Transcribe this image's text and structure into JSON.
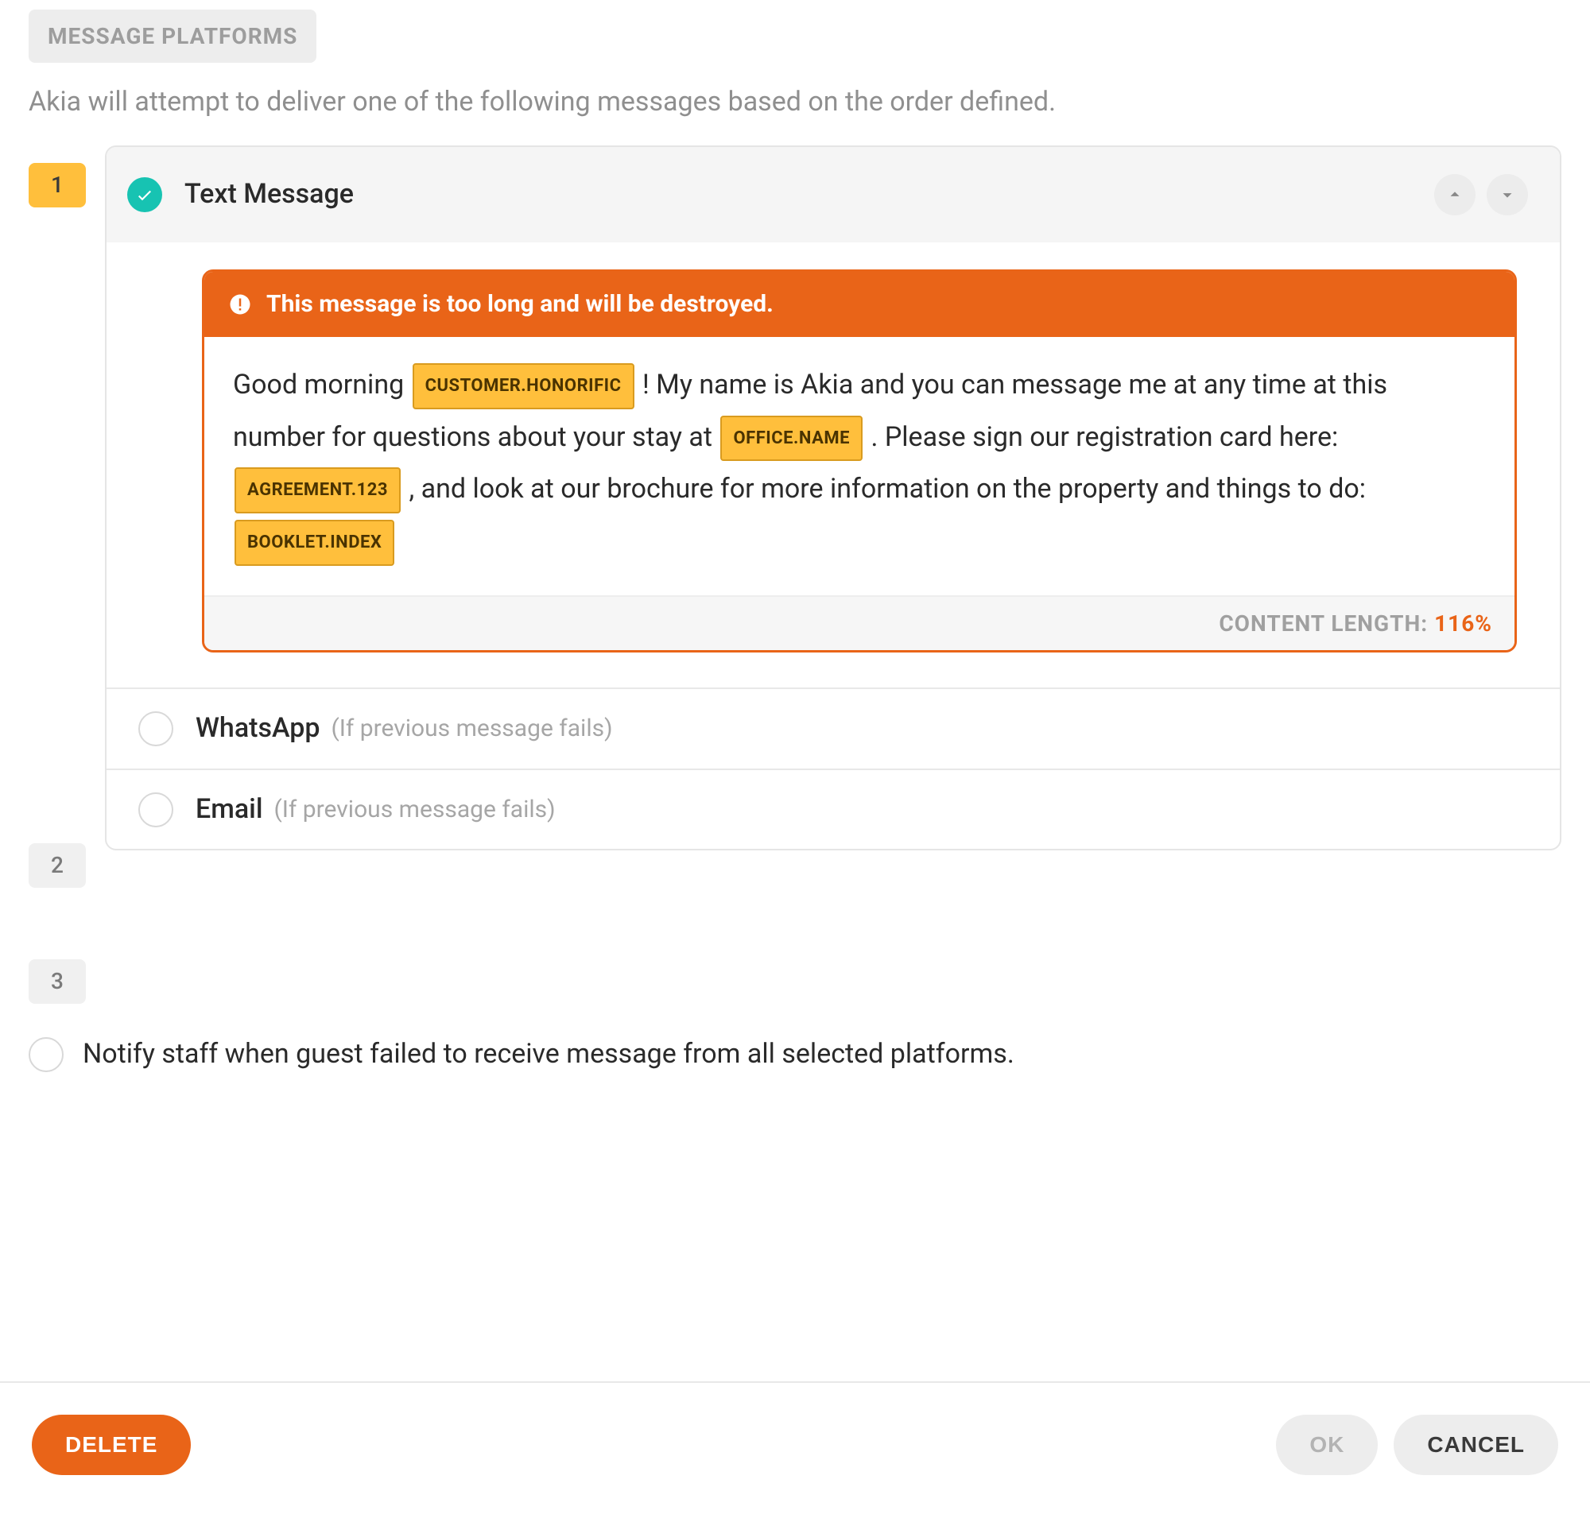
{
  "section": {
    "chip": "MESSAGE PLATFORMS",
    "description": "Akia will attempt to deliver one of the following messages based on the order defined."
  },
  "platforms": [
    {
      "order": "1",
      "active": true,
      "selected": true,
      "title": "Text Message",
      "hint": "",
      "alert": "This message is too long and will be destroyed.",
      "body_seg_1": "Good morning ",
      "token_1": "CUSTOMER.HONORIFIC",
      "body_seg_2": "! My name is Akia and you can message me at any time at this number for questions about your stay at ",
      "token_2": "OFFICE.NAME",
      "body_seg_3": ". Please sign our registration card here: ",
      "token_3": "AGREEMENT.123",
      "body_seg_4": ", and look at our brochure for more information on the property and things to do: ",
      "token_4": "BOOKLET.INDEX",
      "length_label": "CONTENT LENGTH: ",
      "length_value": "116%"
    },
    {
      "order": "2",
      "active": false,
      "selected": false,
      "title": "WhatsApp",
      "hint": "(If previous message fails)"
    },
    {
      "order": "3",
      "active": false,
      "selected": false,
      "title": "Email",
      "hint": "(If previous message fails)"
    }
  ],
  "notify": {
    "label": "Notify staff when guest failed to receive message from all selected platforms."
  },
  "footer": {
    "delete": "DELETE",
    "ok": "OK",
    "cancel": "CANCEL"
  }
}
